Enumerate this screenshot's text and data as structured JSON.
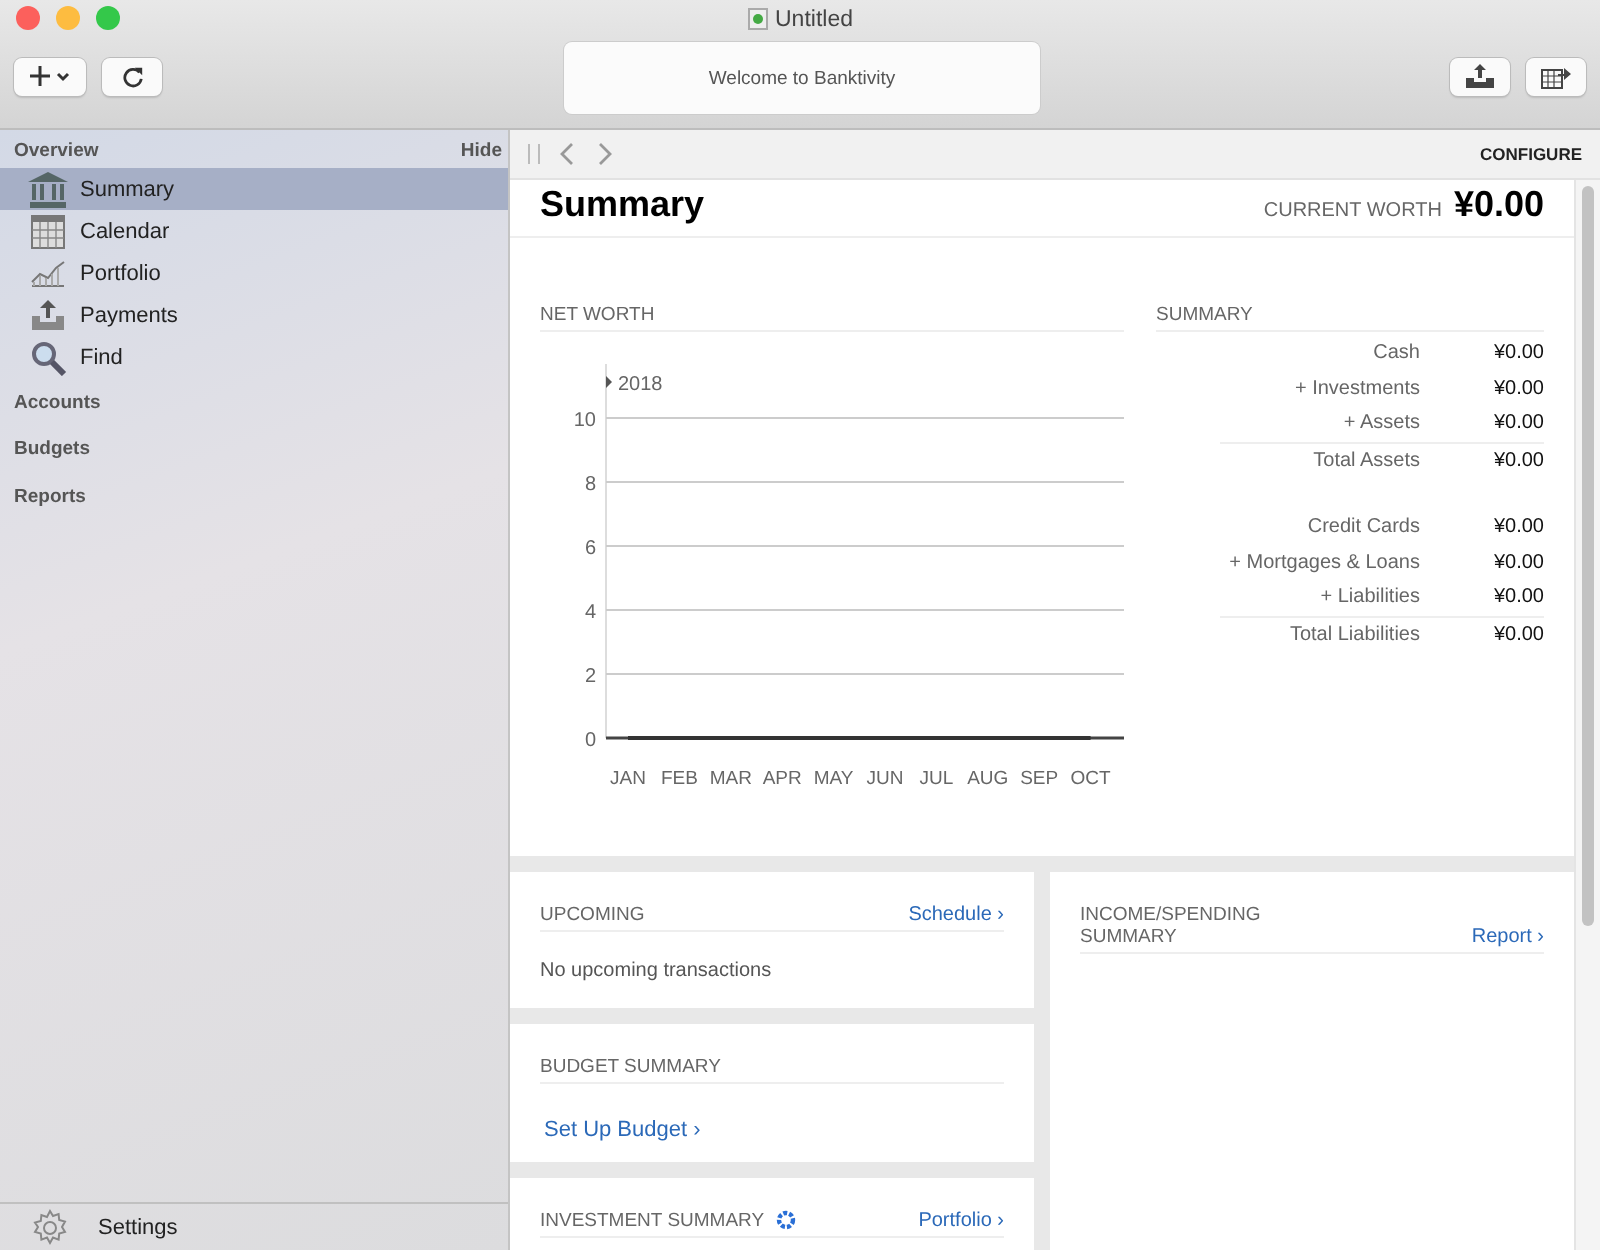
{
  "window": {
    "title": "Untitled"
  },
  "toolbar": {
    "message": "Welcome to Banktivity"
  },
  "sidebar": {
    "header": "Overview",
    "hide": "Hide",
    "items": [
      {
        "label": "Summary",
        "selected": true
      },
      {
        "label": "Calendar",
        "selected": false
      },
      {
        "label": "Portfolio",
        "selected": false
      },
      {
        "label": "Payments",
        "selected": false
      },
      {
        "label": "Find",
        "selected": false
      }
    ],
    "sections": [
      "Accounts",
      "Budgets",
      "Reports"
    ],
    "settings": "Settings"
  },
  "nav": {
    "configure": "CONFIGURE"
  },
  "page": {
    "title": "Summary",
    "worth_label": "CURRENT WORTH",
    "worth": "¥0.00"
  },
  "net_worth": {
    "title": "NET WORTH",
    "year": "2018",
    "chart_data": {
      "type": "line",
      "categories": [
        "JAN",
        "FEB",
        "MAR",
        "APR",
        "MAY",
        "JUN",
        "JUL",
        "AUG",
        "SEP",
        "OCT"
      ],
      "series": [
        {
          "color": "#333333",
          "values": [
            0,
            0,
            0,
            0,
            0,
            0,
            0,
            0,
            0,
            0
          ]
        }
      ],
      "ylim": [
        0,
        10
      ],
      "yticks": [
        0,
        2,
        4,
        6,
        8,
        10
      ],
      "grid": true
    }
  },
  "summary": {
    "title": "SUMMARY",
    "rows": [
      {
        "label": "Cash",
        "value": "¥0.00",
        "kind": "item"
      },
      {
        "label": "+ Investments",
        "value": "¥0.00",
        "kind": "item"
      },
      {
        "label": "+ Assets",
        "value": "¥0.00",
        "kind": "item"
      },
      {
        "label": "Total Assets",
        "value": "¥0.00",
        "kind": "total"
      },
      {
        "label": "Credit Cards",
        "value": "¥0.00",
        "kind": "item"
      },
      {
        "label": "+ Mortgages & Loans",
        "value": "¥0.00",
        "kind": "item"
      },
      {
        "label": "+ Liabilities",
        "value": "¥0.00",
        "kind": "item"
      },
      {
        "label": "Total Liabilities",
        "value": "¥0.00",
        "kind": "total"
      }
    ]
  },
  "upcoming": {
    "title": "UPCOMING",
    "link": "Schedule ›",
    "empty": "No upcoming transactions"
  },
  "budget": {
    "title": "BUDGET SUMMARY",
    "link": "Set Up Budget ›"
  },
  "investment": {
    "title": "INVESTMENT SUMMARY",
    "link": "Portfolio ›"
  },
  "income": {
    "title": "INCOME/SPENDING SUMMARY",
    "link": "Report ›"
  }
}
